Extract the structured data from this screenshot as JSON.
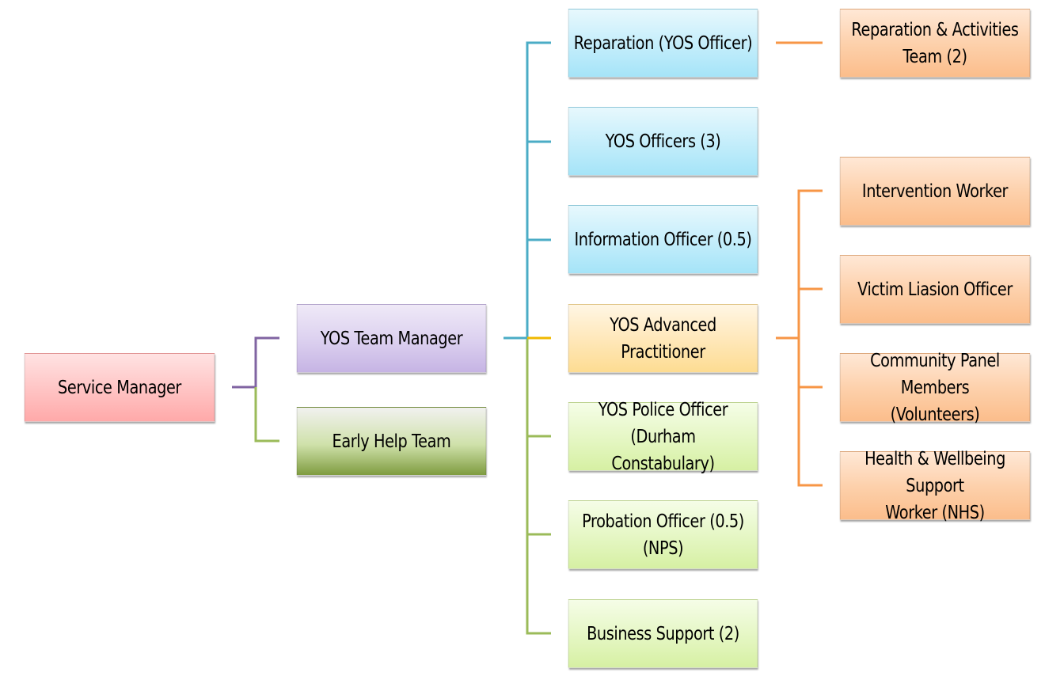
{
  "diagram": {
    "type": "org-chart",
    "colors": {
      "purple_line": "#8064a2",
      "green_line": "#9bbb59",
      "blue_line": "#4bacc6",
      "yellow_line": "#f0b800",
      "orange_line": "#f79646"
    },
    "nodes": {
      "service_manager": "Service Manager",
      "yos_team_manager": "YOS Team Manager",
      "early_help_team": "Early Help Team",
      "reparation_yos_officer": "Reparation (YOS Officer)",
      "yos_officers": "YOS Officers (3)",
      "information_officer": "Information Officer (0.5)",
      "yos_advanced_practitioner": "YOS Advanced Practitioner",
      "yos_police_officer": "YOS Police Officer (Durham\nConstabulary)",
      "probation_officer": "Probation Officer (0.5)\n(NPS)",
      "business_support": "Business Support (2)",
      "reparation_activities_team": "Reparation & Activities\nTeam (2)",
      "intervention_worker": "Intervention Worker",
      "victim_liaison_officer": "Victim Liasion Officer",
      "community_panel_members": "Community Panel Members\n(Volunteers)",
      "health_wellbeing_worker": "Health & Wellbeing Support\nWorker (NHS)"
    },
    "edges": [
      [
        "service_manager",
        "yos_team_manager"
      ],
      [
        "service_manager",
        "early_help_team"
      ],
      [
        "yos_team_manager",
        "reparation_yos_officer"
      ],
      [
        "yos_team_manager",
        "yos_officers"
      ],
      [
        "yos_team_manager",
        "information_officer"
      ],
      [
        "yos_team_manager",
        "yos_advanced_practitioner"
      ],
      [
        "yos_team_manager",
        "yos_police_officer"
      ],
      [
        "yos_team_manager",
        "probation_officer"
      ],
      [
        "yos_team_manager",
        "business_support"
      ],
      [
        "reparation_yos_officer",
        "reparation_activities_team"
      ],
      [
        "yos_advanced_practitioner",
        "intervention_worker"
      ],
      [
        "yos_advanced_practitioner",
        "victim_liaison_officer"
      ],
      [
        "yos_advanced_practitioner",
        "community_panel_members"
      ],
      [
        "yos_advanced_practitioner",
        "health_wellbeing_worker"
      ]
    ]
  }
}
